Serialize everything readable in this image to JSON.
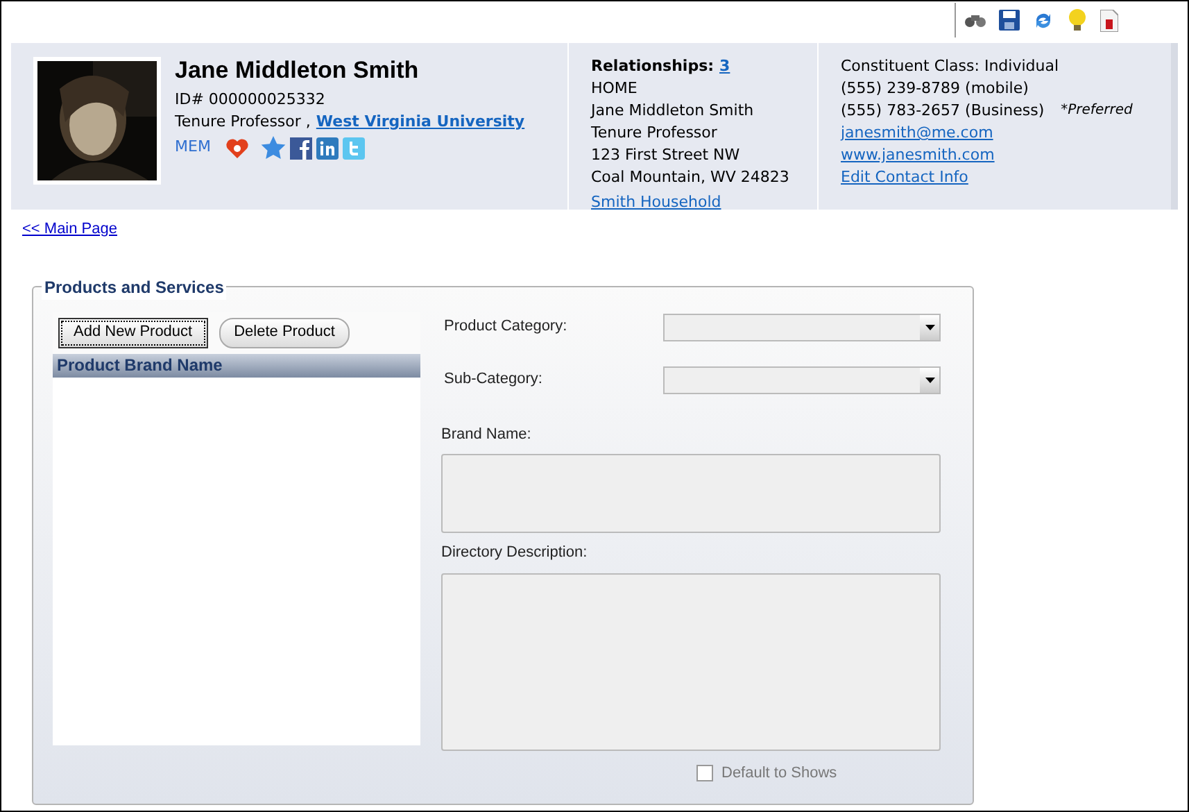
{
  "profile": {
    "name": "Jane Middleton Smith",
    "id": "ID# 000000025332",
    "title": "Tenure Professor ,",
    "organization": "West Virginia University",
    "membership": "MEM"
  },
  "relationships": {
    "label": "Relationships:",
    "count": "3",
    "lines": [
      "HOME",
      "Jane Middleton Smith",
      "Tenure Professor",
      "123 First Street NW",
      "Coal Mountain, WV 24823"
    ],
    "household": "Smith Household"
  },
  "contact": {
    "constituent_class": "Constituent Class: Individual",
    "phones": [
      {
        "number": "(555) 239-8789 (mobile)"
      },
      {
        "number": "(555) 783-2657 (Business)",
        "note": "*Preferred"
      }
    ],
    "email": "janesmith@me.com",
    "website": "www.janesmith.com",
    "edit_link": "Edit Contact Info"
  },
  "main_link": "<< Main Page",
  "products": {
    "title": "Products and Services",
    "buttons": [
      {
        "label": "Add New Product",
        "focused": true
      },
      {
        "label": "Delete Product",
        "focused": false
      }
    ],
    "list_header": "Product Brand Name",
    "fields": [
      {
        "kind": "select",
        "label": "Product Category:"
      },
      {
        "kind": "select",
        "label": "Sub-Category:"
      },
      {
        "kind": "textarea",
        "label": "Brand Name:"
      },
      {
        "kind": "textarea",
        "label": "Directory Description:"
      }
    ],
    "checkbox": {
      "label": "Default to Shows",
      "checked": false
    }
  }
}
